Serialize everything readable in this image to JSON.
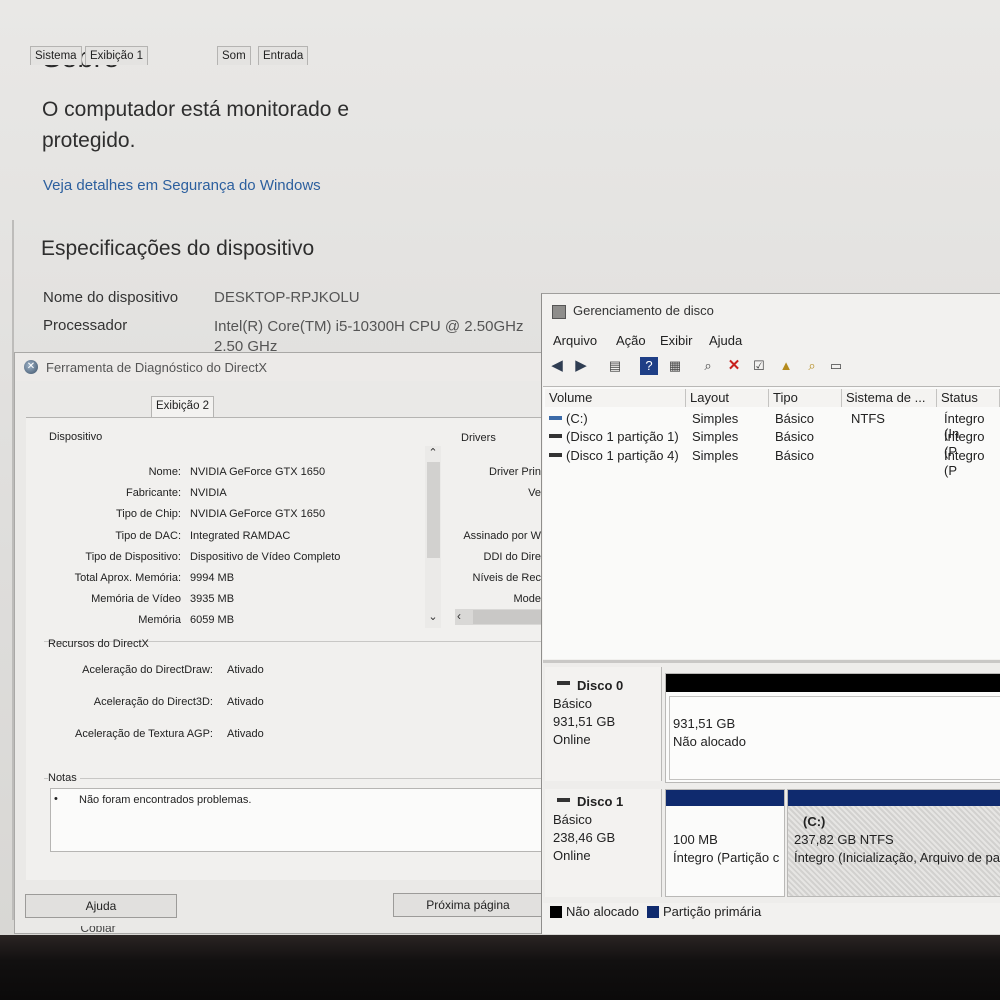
{
  "settings": {
    "title": "Sobre",
    "protection": "O computador está monitorado e protegido.",
    "security_link": "Veja detalhes em Segurança do Windows",
    "specs_title": "Especificações do dispositivo",
    "device_name_label": "Nome do dispositivo",
    "device_name_value": "DESKTOP-RPJKOLU",
    "processor_label": "Processador",
    "processor_value_1": "Intel(R) Core(TM) i5-10300H CPU @ 2.50GHz",
    "processor_value_2": "2.50 GHz"
  },
  "dxdiag": {
    "title": "Ferramenta de Diagnóstico do DirectX",
    "tabs": [
      "Sistema",
      "Exibição 1",
      "Exibição 2",
      "Som",
      "Entrada"
    ],
    "device_group": "Dispositivo",
    "drivers_group": "Drivers",
    "device_rows": [
      {
        "label": "Nome:",
        "value": "NVIDIA GeForce GTX 1650"
      },
      {
        "label": "Fabricante:",
        "value": "NVIDIA"
      },
      {
        "label": "Tipo de Chip:",
        "value": "NVIDIA GeForce GTX 1650"
      },
      {
        "label": "Tipo de DAC:",
        "value": "Integrated RAMDAC"
      },
      {
        "label": "Tipo de Dispositivo:",
        "value": "Dispositivo de Vídeo Completo"
      },
      {
        "label": "Total Aprox. Memória:",
        "value": "9994 MB"
      },
      {
        "label": "Memória de Vídeo",
        "value": "3935 MB"
      },
      {
        "label": "Memória",
        "value": "6059 MB"
      }
    ],
    "driver_rows": [
      "Driver Prin",
      "Ve",
      "Assinado por W",
      "DDI do Dire",
      "Níveis de Rec",
      "Mode"
    ],
    "directx_group": "Recursos do DirectX",
    "feature_rows": [
      {
        "label": "Aceleração do DirectDraw:",
        "value": "Ativado"
      },
      {
        "label": "Aceleração do Direct3D:",
        "value": "Ativado"
      },
      {
        "label": "Aceleração de Textura AGP:",
        "value": "Ativado"
      }
    ],
    "notes_group": "Notas",
    "notes_item": "Não foram encontrados problemas.",
    "help_button": "Ajuda",
    "next_button": "Próxima página",
    "copy_button": "Copiar"
  },
  "diskmgmt": {
    "title": "Gerenciamento de disco",
    "menu": [
      "Arquivo",
      "Ação",
      "Exibir",
      "Ajuda"
    ],
    "columns": [
      "Volume",
      "Layout",
      "Tipo",
      "Sistema de ...",
      "Status"
    ],
    "volumes": [
      {
        "volume": "(C:)",
        "layout": "Simples",
        "tipo": "Básico",
        "fs": "NTFS",
        "status": "Íntegro (In"
      },
      {
        "volume": "(Disco 1 partição 1)",
        "layout": "Simples",
        "tipo": "Básico",
        "fs": "",
        "status": "Íntegro (P"
      },
      {
        "volume": "(Disco 1 partição 4)",
        "layout": "Simples",
        "tipo": "Básico",
        "fs": "",
        "status": "Íntegro (P"
      }
    ],
    "disk0": {
      "name": "Disco 0",
      "type": "Básico",
      "size": "931,51 GB",
      "state": "Online",
      "seg_size": "931,51 GB",
      "seg_status": "Não alocado"
    },
    "disk1": {
      "name": "Disco 1",
      "type": "Básico",
      "size": "238,46 GB",
      "state": "Online",
      "seg1_size": "100 MB",
      "seg1_status": "Íntegro (Partição c",
      "seg2_name": "(C:)",
      "seg2_size": "237,82 GB NTFS",
      "seg2_status": "Íntegro (Inicialização, Arquivo de pa"
    },
    "legend": {
      "unallocated": "Não alocado",
      "primary": "Partição primária"
    },
    "colors": {
      "unallocated": "#000000",
      "primary": "#0f2a6e"
    }
  }
}
